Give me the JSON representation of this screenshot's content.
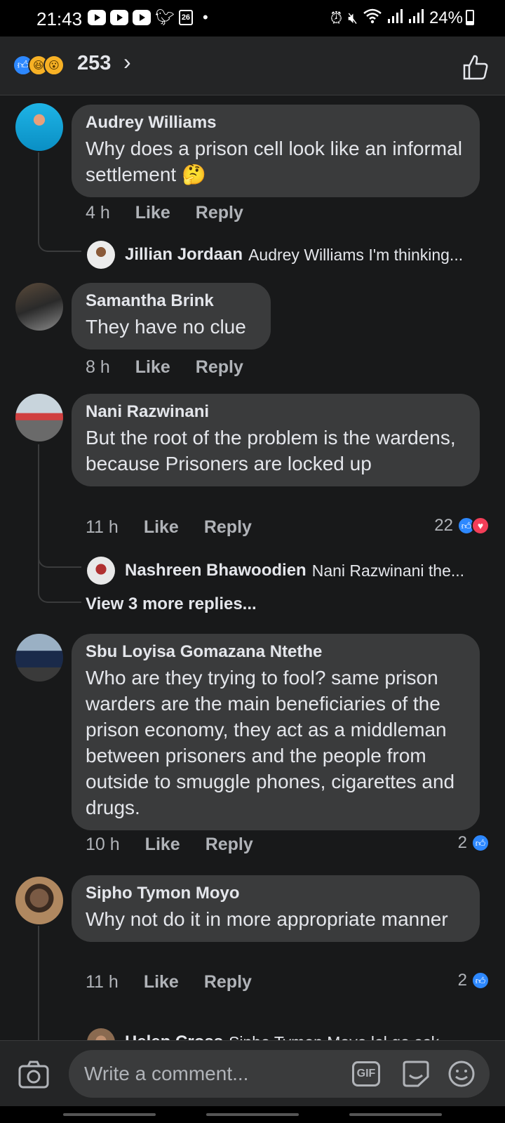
{
  "status_bar": {
    "time": "21:43",
    "calendar_day": "26",
    "dot": "•",
    "battery": "24%"
  },
  "post_header": {
    "reaction_count": "253",
    "reaction_icons": [
      "like-icon",
      "haha-icon",
      "wow-icon"
    ]
  },
  "comments": [
    {
      "author": "Audrey Williams",
      "text": "Why does a prison cell look like an informal settlement 🤔",
      "time": "4 h",
      "like_label": "Like",
      "reply_label": "Reply",
      "reply": {
        "author": "Jillian Jordaan",
        "text": "Audrey Williams I'm thinking..."
      }
    },
    {
      "author": "Samantha Brink",
      "text": "They have no clue",
      "time": "8 h",
      "like_label": "Like",
      "reply_label": "Reply"
    },
    {
      "author": "Nani Razwinani",
      "text": "But the root of the problem is the wardens, because Prisoners are locked up",
      "time": "11 h",
      "like_label": "Like",
      "reply_label": "Reply",
      "reactions": "22",
      "reply": {
        "author": "Nashreen Bhawoodien",
        "text": "Nani Razwinani the..."
      },
      "more_replies": "View 3 more replies..."
    },
    {
      "author": "Sbu Loyisa Gomazana Ntethe",
      "text": "Who are they trying to fool? same prison warders are the main beneficiaries of the prison economy, they act as a middleman between prisoners and the people from outside to smuggle phones, cigarettes and drugs.",
      "time": "10 h",
      "like_label": "Like",
      "reply_label": "Reply",
      "reactions": "2"
    },
    {
      "author": "Sipho Tymon Moyo",
      "text": "Why not do it in more appropriate manner",
      "time": "11 h",
      "like_label": "Like",
      "reply_label": "Reply",
      "reactions": "2",
      "reply": {
        "author": "Helen Cross",
        "text": "Sipho Tymon Moyo lol go ask"
      }
    }
  ],
  "composer": {
    "placeholder": "Write a comment...",
    "gif_label": "GIF"
  },
  "colors": {
    "background": "#18191a",
    "bubble": "#3a3b3c",
    "like_blue": "#2d88ff",
    "love_red": "#f33e58",
    "secondary_text": "#b0b3b8"
  }
}
